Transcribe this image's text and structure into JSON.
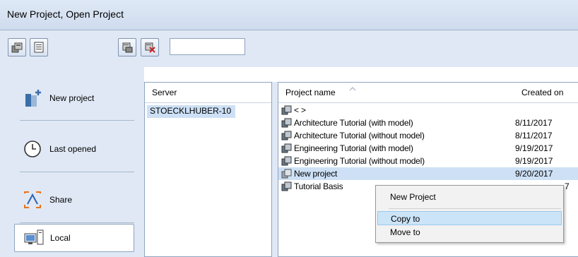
{
  "window": {
    "title": "New Project, Open Project"
  },
  "toolbar": {
    "search_value": ""
  },
  "nav": {
    "new_project": "New project",
    "last_opened": "Last opened",
    "share": "Share",
    "local": "Local"
  },
  "server_list": {
    "header": "Server",
    "items": [
      "STOECKLHUBER-10"
    ]
  },
  "project_list": {
    "headers": {
      "name": "Project name",
      "created": "Created on"
    },
    "rows": [
      {
        "name": "<      >",
        "created": ""
      },
      {
        "name": "Architecture Tutorial (with model)",
        "created": "8/11/2017"
      },
      {
        "name": "Architecture Tutorial (without model)",
        "created": "8/11/2017"
      },
      {
        "name": "Engineering Tutorial (with model)",
        "created": "9/19/2017"
      },
      {
        "name": "Engineering Tutorial (without model)",
        "created": "9/19/2017"
      },
      {
        "name": "New project",
        "created": "9/20/2017"
      },
      {
        "name": "Tutorial Basis",
        "created": "7"
      }
    ]
  },
  "context_menu": {
    "new_project": "New Project",
    "copy_to": "Copy to",
    "move_to": "Move to"
  },
  "colors": {
    "selection": "#cde0f5",
    "panel": "#dfe8f4",
    "title_bg": "#d6e2f1"
  }
}
